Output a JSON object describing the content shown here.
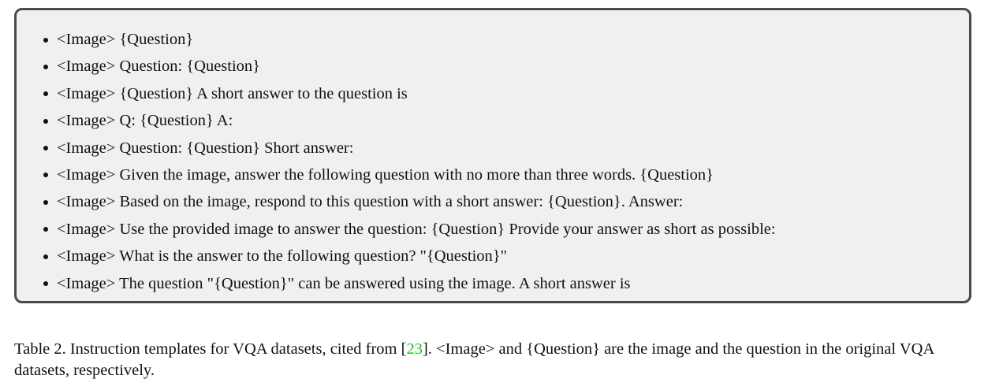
{
  "templates": [
    "<Image> {Question}",
    "<Image> Question: {Question}",
    "<Image> {Question} A short answer to the question is",
    "<Image> Q: {Question} A:",
    "<Image> Question: {Question} Short answer:",
    "<Image> Given the image, answer the following question with no more than three words. {Question}",
    "<Image> Based on the image, respond to this question with a short answer: {Question}. Answer:",
    "<Image> Use the provided image to answer the question: {Question} Provide your answer as short as possible:",
    "<Image> What is the answer to the following question? \"{Question}\"",
    "<Image> The question \"{Question}\" can be answered using the image. A short answer is"
  ],
  "caption": {
    "before_citation": "Table 2. Instruction templates for VQA datasets, cited from [",
    "citation": "23",
    "after_citation": "]. <Image> and {Question} are the image and the question in the original VQA datasets, respectively.",
    "citation_color": "#19c419"
  }
}
